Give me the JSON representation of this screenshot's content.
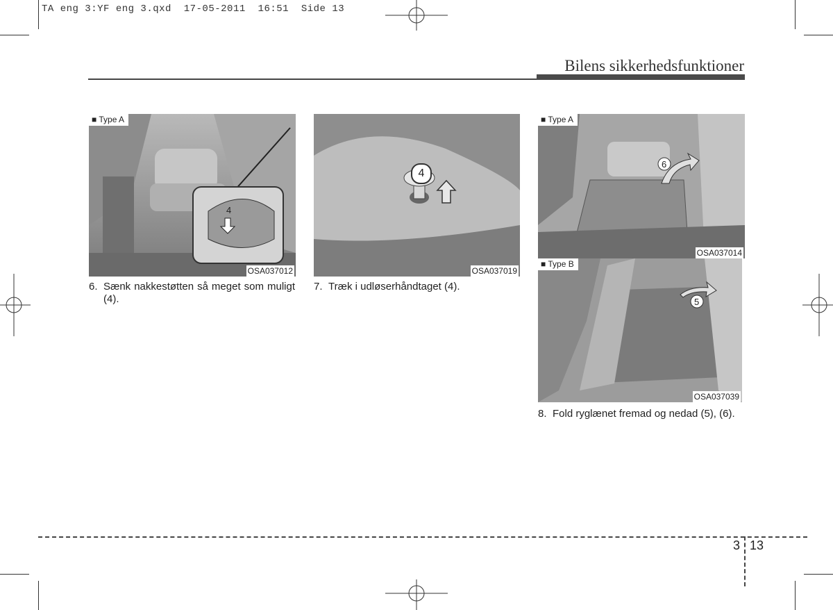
{
  "slug": "TA eng 3:YF eng 3.qxd  17-05-2011  16:51  Side 13",
  "header": {
    "title": "Bilens sikkerhedsfunktioner"
  },
  "figures": [
    {
      "tag": "■ Type A",
      "code": "OSA037012",
      "callout": "4"
    },
    {
      "code": "OSA037019",
      "callout": "4"
    },
    {
      "tag": "■ Type A",
      "code": "OSA037014",
      "callout": "6"
    },
    {
      "tag": "■ Type B",
      "code": "OSA037039",
      "callout": "5"
    }
  ],
  "steps": [
    {
      "num": "6.",
      "text": "Sænk nakkestøtten så meget som muligt (4)."
    },
    {
      "num": "7.",
      "text": "Træk i udløserhåndtaget (4)."
    },
    {
      "num": "8.",
      "text": "Fold ryglænet fremad og nedad (5), (6)."
    }
  ],
  "footer": {
    "chapter": "3",
    "page": "13"
  }
}
